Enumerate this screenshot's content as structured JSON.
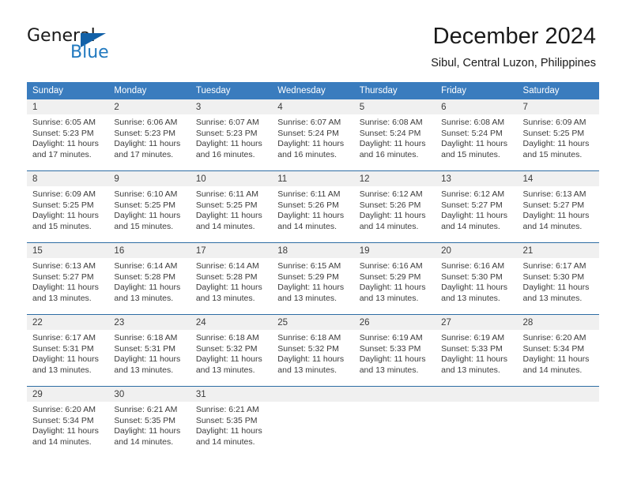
{
  "brand": {
    "name_part1": "General",
    "name_part2": "Blue",
    "logo_icon": "blue-triangle-flag-icon"
  },
  "header": {
    "title": "December 2024",
    "subtitle": "Sibul, Central Luzon, Philippines"
  },
  "colors": {
    "header_blue": "#3a7cbe",
    "rule_blue": "#2e6da4",
    "brand_blue": "#2179bf",
    "daynum_band": "#f0f0f0",
    "text": "#3b3b3b"
  },
  "weekday_headers": [
    "Sunday",
    "Monday",
    "Tuesday",
    "Wednesday",
    "Thursday",
    "Friday",
    "Saturday"
  ],
  "weeks": [
    [
      {
        "day": "1",
        "sunrise": "Sunrise: 6:05 AM",
        "sunset": "Sunset: 5:23 PM",
        "daylight_line1": "Daylight: 11 hours",
        "daylight_line2": "and 17 minutes."
      },
      {
        "day": "2",
        "sunrise": "Sunrise: 6:06 AM",
        "sunset": "Sunset: 5:23 PM",
        "daylight_line1": "Daylight: 11 hours",
        "daylight_line2": "and 17 minutes."
      },
      {
        "day": "3",
        "sunrise": "Sunrise: 6:07 AM",
        "sunset": "Sunset: 5:23 PM",
        "daylight_line1": "Daylight: 11 hours",
        "daylight_line2": "and 16 minutes."
      },
      {
        "day": "4",
        "sunrise": "Sunrise: 6:07 AM",
        "sunset": "Sunset: 5:24 PM",
        "daylight_line1": "Daylight: 11 hours",
        "daylight_line2": "and 16 minutes."
      },
      {
        "day": "5",
        "sunrise": "Sunrise: 6:08 AM",
        "sunset": "Sunset: 5:24 PM",
        "daylight_line1": "Daylight: 11 hours",
        "daylight_line2": "and 16 minutes."
      },
      {
        "day": "6",
        "sunrise": "Sunrise: 6:08 AM",
        "sunset": "Sunset: 5:24 PM",
        "daylight_line1": "Daylight: 11 hours",
        "daylight_line2": "and 15 minutes."
      },
      {
        "day": "7",
        "sunrise": "Sunrise: 6:09 AM",
        "sunset": "Sunset: 5:25 PM",
        "daylight_line1": "Daylight: 11 hours",
        "daylight_line2": "and 15 minutes."
      }
    ],
    [
      {
        "day": "8",
        "sunrise": "Sunrise: 6:09 AM",
        "sunset": "Sunset: 5:25 PM",
        "daylight_line1": "Daylight: 11 hours",
        "daylight_line2": "and 15 minutes."
      },
      {
        "day": "9",
        "sunrise": "Sunrise: 6:10 AM",
        "sunset": "Sunset: 5:25 PM",
        "daylight_line1": "Daylight: 11 hours",
        "daylight_line2": "and 15 minutes."
      },
      {
        "day": "10",
        "sunrise": "Sunrise: 6:11 AM",
        "sunset": "Sunset: 5:25 PM",
        "daylight_line1": "Daylight: 11 hours",
        "daylight_line2": "and 14 minutes."
      },
      {
        "day": "11",
        "sunrise": "Sunrise: 6:11 AM",
        "sunset": "Sunset: 5:26 PM",
        "daylight_line1": "Daylight: 11 hours",
        "daylight_line2": "and 14 minutes."
      },
      {
        "day": "12",
        "sunrise": "Sunrise: 6:12 AM",
        "sunset": "Sunset: 5:26 PM",
        "daylight_line1": "Daylight: 11 hours",
        "daylight_line2": "and 14 minutes."
      },
      {
        "day": "13",
        "sunrise": "Sunrise: 6:12 AM",
        "sunset": "Sunset: 5:27 PM",
        "daylight_line1": "Daylight: 11 hours",
        "daylight_line2": "and 14 minutes."
      },
      {
        "day": "14",
        "sunrise": "Sunrise: 6:13 AM",
        "sunset": "Sunset: 5:27 PM",
        "daylight_line1": "Daylight: 11 hours",
        "daylight_line2": "and 14 minutes."
      }
    ],
    [
      {
        "day": "15",
        "sunrise": "Sunrise: 6:13 AM",
        "sunset": "Sunset: 5:27 PM",
        "daylight_line1": "Daylight: 11 hours",
        "daylight_line2": "and 13 minutes."
      },
      {
        "day": "16",
        "sunrise": "Sunrise: 6:14 AM",
        "sunset": "Sunset: 5:28 PM",
        "daylight_line1": "Daylight: 11 hours",
        "daylight_line2": "and 13 minutes."
      },
      {
        "day": "17",
        "sunrise": "Sunrise: 6:14 AM",
        "sunset": "Sunset: 5:28 PM",
        "daylight_line1": "Daylight: 11 hours",
        "daylight_line2": "and 13 minutes."
      },
      {
        "day": "18",
        "sunrise": "Sunrise: 6:15 AM",
        "sunset": "Sunset: 5:29 PM",
        "daylight_line1": "Daylight: 11 hours",
        "daylight_line2": "and 13 minutes."
      },
      {
        "day": "19",
        "sunrise": "Sunrise: 6:16 AM",
        "sunset": "Sunset: 5:29 PM",
        "daylight_line1": "Daylight: 11 hours",
        "daylight_line2": "and 13 minutes."
      },
      {
        "day": "20",
        "sunrise": "Sunrise: 6:16 AM",
        "sunset": "Sunset: 5:30 PM",
        "daylight_line1": "Daylight: 11 hours",
        "daylight_line2": "and 13 minutes."
      },
      {
        "day": "21",
        "sunrise": "Sunrise: 6:17 AM",
        "sunset": "Sunset: 5:30 PM",
        "daylight_line1": "Daylight: 11 hours",
        "daylight_line2": "and 13 minutes."
      }
    ],
    [
      {
        "day": "22",
        "sunrise": "Sunrise: 6:17 AM",
        "sunset": "Sunset: 5:31 PM",
        "daylight_line1": "Daylight: 11 hours",
        "daylight_line2": "and 13 minutes."
      },
      {
        "day": "23",
        "sunrise": "Sunrise: 6:18 AM",
        "sunset": "Sunset: 5:31 PM",
        "daylight_line1": "Daylight: 11 hours",
        "daylight_line2": "and 13 minutes."
      },
      {
        "day": "24",
        "sunrise": "Sunrise: 6:18 AM",
        "sunset": "Sunset: 5:32 PM",
        "daylight_line1": "Daylight: 11 hours",
        "daylight_line2": "and 13 minutes."
      },
      {
        "day": "25",
        "sunrise": "Sunrise: 6:18 AM",
        "sunset": "Sunset: 5:32 PM",
        "daylight_line1": "Daylight: 11 hours",
        "daylight_line2": "and 13 minutes."
      },
      {
        "day": "26",
        "sunrise": "Sunrise: 6:19 AM",
        "sunset": "Sunset: 5:33 PM",
        "daylight_line1": "Daylight: 11 hours",
        "daylight_line2": "and 13 minutes."
      },
      {
        "day": "27",
        "sunrise": "Sunrise: 6:19 AM",
        "sunset": "Sunset: 5:33 PM",
        "daylight_line1": "Daylight: 11 hours",
        "daylight_line2": "and 13 minutes."
      },
      {
        "day": "28",
        "sunrise": "Sunrise: 6:20 AM",
        "sunset": "Sunset: 5:34 PM",
        "daylight_line1": "Daylight: 11 hours",
        "daylight_line2": "and 14 minutes."
      }
    ],
    [
      {
        "day": "29",
        "sunrise": "Sunrise: 6:20 AM",
        "sunset": "Sunset: 5:34 PM",
        "daylight_line1": "Daylight: 11 hours",
        "daylight_line2": "and 14 minutes."
      },
      {
        "day": "30",
        "sunrise": "Sunrise: 6:21 AM",
        "sunset": "Sunset: 5:35 PM",
        "daylight_line1": "Daylight: 11 hours",
        "daylight_line2": "and 14 minutes."
      },
      {
        "day": "31",
        "sunrise": "Sunrise: 6:21 AM",
        "sunset": "Sunset: 5:35 PM",
        "daylight_line1": "Daylight: 11 hours",
        "daylight_line2": "and 14 minutes."
      },
      {
        "day": "",
        "sunrise": "",
        "sunset": "",
        "daylight_line1": "",
        "daylight_line2": ""
      },
      {
        "day": "",
        "sunrise": "",
        "sunset": "",
        "daylight_line1": "",
        "daylight_line2": ""
      },
      {
        "day": "",
        "sunrise": "",
        "sunset": "",
        "daylight_line1": "",
        "daylight_line2": ""
      },
      {
        "day": "",
        "sunrise": "",
        "sunset": "",
        "daylight_line1": "",
        "daylight_line2": ""
      }
    ]
  ]
}
